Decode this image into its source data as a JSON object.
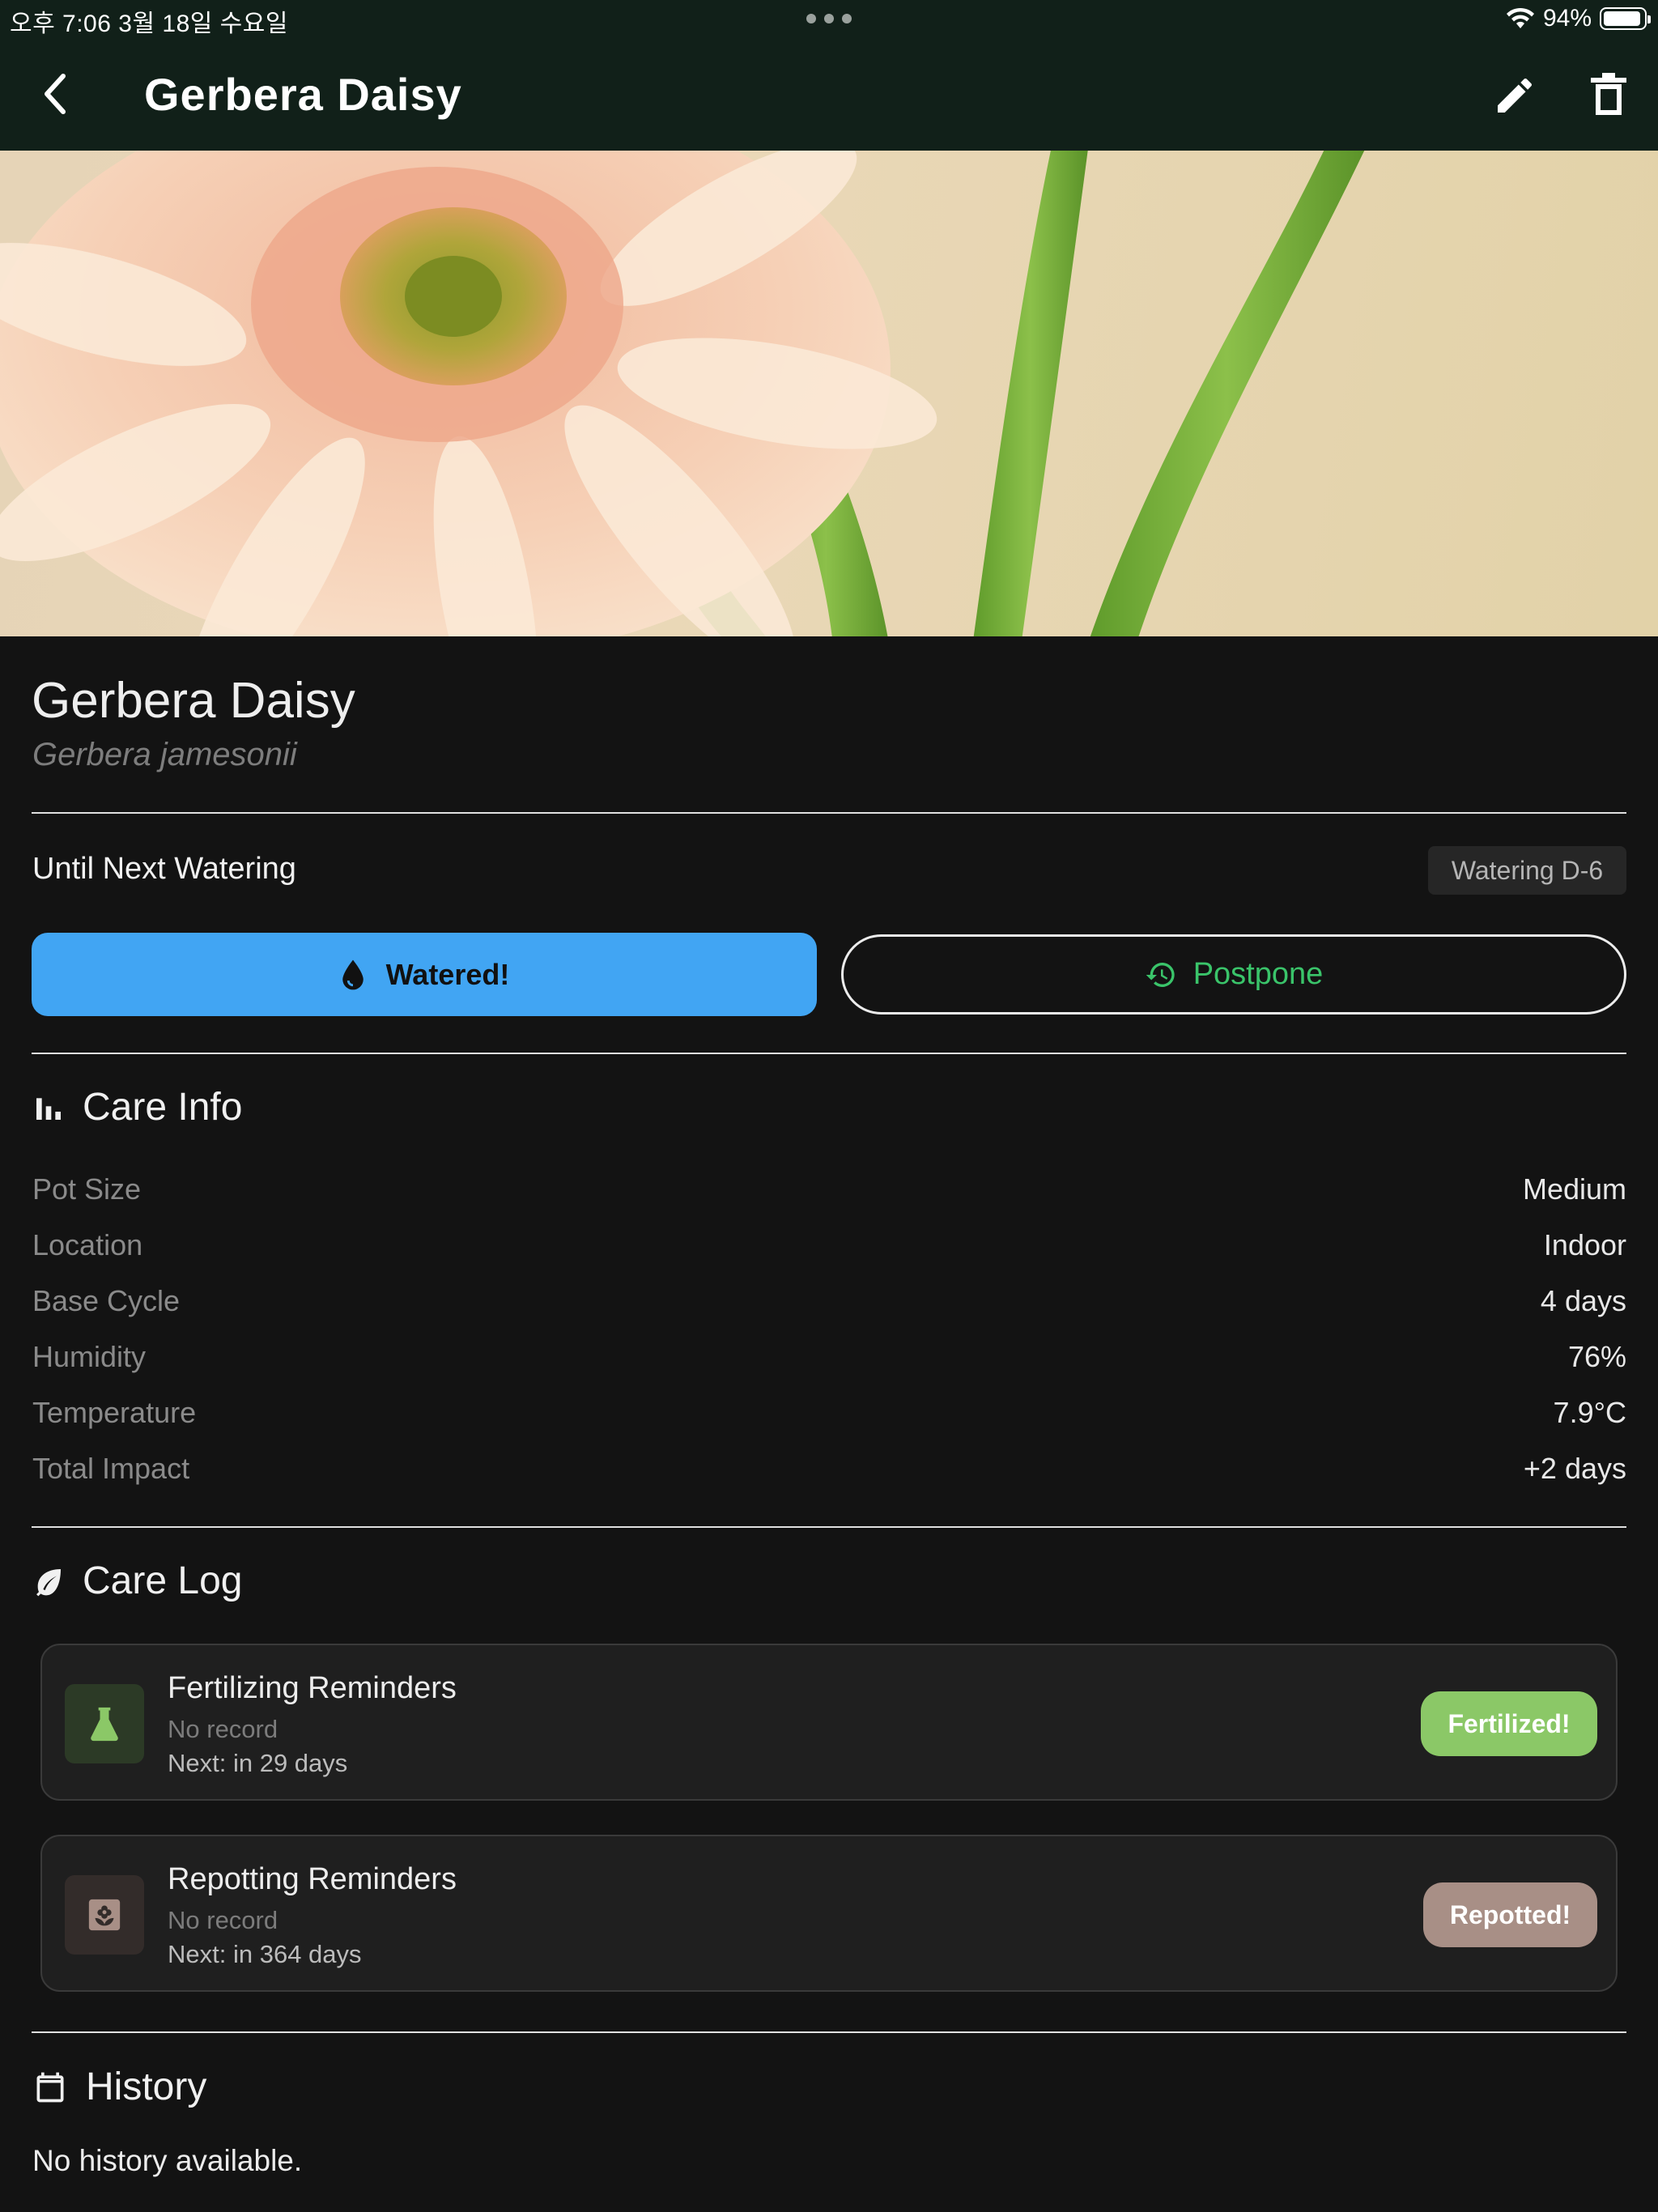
{
  "status_bar": {
    "time_date": "오후 7:06   3월 18일 수요일",
    "battery_percent": "94%",
    "battery_level": 0.94
  },
  "app_bar": {
    "title": "Gerbera Daisy"
  },
  "plant": {
    "name": "Gerbera Daisy",
    "scientific_name": "Gerbera jamesonii"
  },
  "watering": {
    "label": "Until Next Watering",
    "badge": "Watering D-6",
    "watered_button": "Watered!",
    "postpone_button": "Postpone"
  },
  "care_info": {
    "title": "Care Info",
    "rows": [
      {
        "key": "Pot Size",
        "value": "Medium"
      },
      {
        "key": "Location",
        "value": "Indoor"
      },
      {
        "key": "Base Cycle",
        "value": "4 days"
      },
      {
        "key": "Humidity",
        "value": "76%"
      },
      {
        "key": "Temperature",
        "value": "7.9°C"
      },
      {
        "key": "Total Impact",
        "value": "+2 days"
      }
    ]
  },
  "care_log": {
    "title": "Care Log",
    "items": [
      {
        "title": "Fertilizing Reminders",
        "status": "No record",
        "next": "Next: in 29 days",
        "button": "Fertilized!",
        "icon": "flask-icon",
        "button_color": "#8bc867",
        "icon_bg": "#2c3a26",
        "icon_color": "#8bc867"
      },
      {
        "title": "Repotting Reminders",
        "status": "No record",
        "next": "Next: in 364 days",
        "button": "Repotted!",
        "icon": "flower-pot-icon",
        "button_color": "#a88f86",
        "icon_bg": "#332c2a",
        "icon_color": "#a88f86"
      }
    ]
  },
  "history": {
    "title": "History",
    "empty_text": "No history available."
  },
  "colors": {
    "appbar": "#112019",
    "primary_blue": "#41a5f3",
    "accent_green": "#3ac46a",
    "background": "#131313"
  }
}
